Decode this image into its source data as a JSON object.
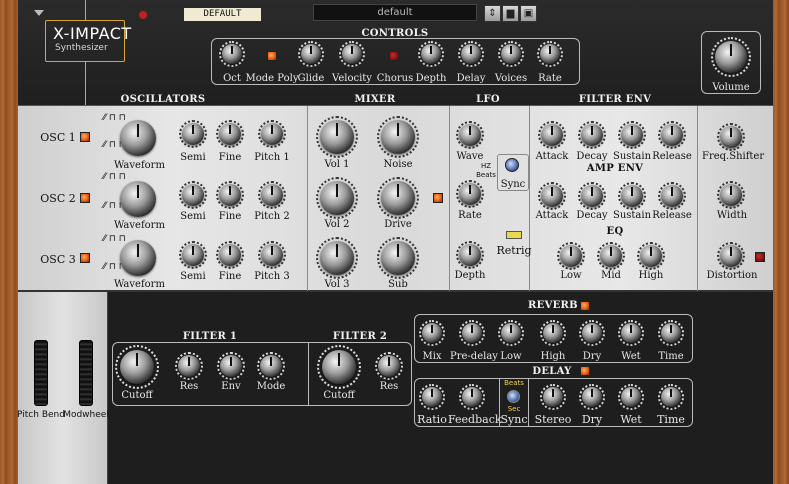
{
  "header": {
    "logo_title": "X-IMPACT",
    "logo_subtitle": "Synthesizer",
    "preset_tag": "DEFAULT",
    "preset_name": "default",
    "volume_label": "Volume"
  },
  "controls": {
    "title": "CONTROLS",
    "items": [
      "Oct",
      "Mode Poly",
      "Glide",
      "Velocity",
      "Chorus",
      "Depth",
      "Delay",
      "Voices",
      "Rate"
    ]
  },
  "sections": {
    "oscillators": "OSCILLATORS",
    "mixer": "MIXER",
    "lfo": "LFO",
    "filter_env": "FILTER ENV",
    "amp_env": "AMP ENV",
    "eq": "EQ",
    "reverb": "REVERB",
    "delay": "DELAY",
    "filter1": "FILTER 1",
    "filter2": "FILTER 2"
  },
  "osc": [
    {
      "name": "OSC 1",
      "waveform": "Waveform",
      "semi": "Semi",
      "fine": "Fine",
      "pitch": "Pitch 1"
    },
    {
      "name": "OSC 2",
      "waveform": "Waveform",
      "semi": "Semi",
      "fine": "Fine",
      "pitch": "Pitch 2"
    },
    {
      "name": "OSC 3",
      "waveform": "Waveform",
      "semi": "Semi",
      "fine": "Fine",
      "pitch": "Pitch 3"
    }
  ],
  "mixer": [
    "Vol 1",
    "Noise",
    "Vol 2",
    "Drive",
    "Vol 3",
    "Sub"
  ],
  "lfo": {
    "wave": "Wave",
    "sync": "Sync",
    "hz": "HZ",
    "beats": "Beats",
    "rate": "Rate",
    "retrig": "Retrig",
    "depth": "Depth"
  },
  "filter_env": [
    "Attack",
    "Decay",
    "Sustain",
    "Release"
  ],
  "amp_env": [
    "Attack",
    "Decay",
    "Sustain",
    "Release"
  ],
  "eq": [
    "Low",
    "Mid",
    "High"
  ],
  "right_col": [
    "Freq.Shifter",
    "Width",
    "Distortion"
  ],
  "wheels": {
    "pitch_bend": "Pitch Bend",
    "modwheel": "Modwheel"
  },
  "filter1": [
    "Cutoff",
    "Res",
    "Env",
    "Mode"
  ],
  "filter2": [
    "Cutoff",
    "Res"
  ],
  "reverb": [
    "Mix",
    "Pre-delay",
    "Low",
    "High",
    "Dry",
    "Wet",
    "Time"
  ],
  "delay": {
    "items": [
      "Ratio",
      "Feedback",
      "Sync",
      "Stereo",
      "Dry",
      "Wet",
      "Time"
    ],
    "beats": "Beats",
    "sec": "Sec"
  }
}
